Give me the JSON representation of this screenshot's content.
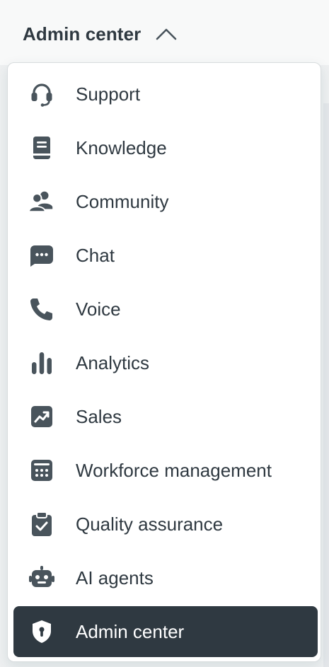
{
  "header": {
    "title": "Admin center",
    "chevron_icon": "chevron-up-icon"
  },
  "menu": {
    "items": [
      {
        "label": "Support",
        "icon": "headset-icon"
      },
      {
        "label": "Knowledge",
        "icon": "book-icon"
      },
      {
        "label": "Community",
        "icon": "people-icon"
      },
      {
        "label": "Chat",
        "icon": "chat-bubble-icon"
      },
      {
        "label": "Voice",
        "icon": "phone-icon"
      },
      {
        "label": "Analytics",
        "icon": "bar-chart-icon"
      },
      {
        "label": "Sales",
        "icon": "trend-up-icon"
      },
      {
        "label": "Workforce management",
        "icon": "calendar-icon"
      },
      {
        "label": "Quality assurance",
        "icon": "clipboard-check-icon"
      },
      {
        "label": "AI agents",
        "icon": "robot-icon"
      },
      {
        "label": "Admin center",
        "icon": "shield-icon",
        "active": true
      }
    ]
  },
  "colors": {
    "text": "#2f3941",
    "icon": "#49545c",
    "active_bg": "#2f3941",
    "active_text": "#ffffff"
  }
}
